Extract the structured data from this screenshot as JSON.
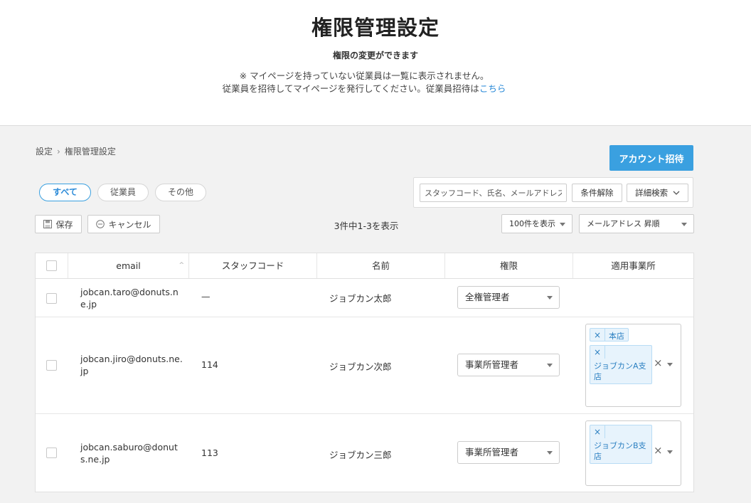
{
  "header": {
    "title": "権限管理設定",
    "subtitle": "権限の変更ができます",
    "note_line1": "※ マイページを持っていない従業員は一覧に表示されません。",
    "note_line2_prefix": "従業員を招待してマイページを発行してください。従業員招待は",
    "note_link": "こちら"
  },
  "breadcrumb": {
    "root": "設定",
    "separator": "›",
    "current": "権限管理設定"
  },
  "invite_button": "アカウント招待",
  "filter_tabs": [
    {
      "label": "すべて",
      "active": true
    },
    {
      "label": "従業員",
      "active": false
    },
    {
      "label": "その他",
      "active": false
    }
  ],
  "search": {
    "placeholder": "スタッフコード、氏名、メールアドレス",
    "clear_label": "条件解除",
    "advanced_label": "詳細検索"
  },
  "toolbar": {
    "save_label": "保存",
    "cancel_label": "キャンセル",
    "count_text": "3件中1-3を表示",
    "per_page": "100件を表示",
    "sort": "メールアドレス 昇順"
  },
  "table": {
    "columns": [
      "email",
      "スタッフコード",
      "名前",
      "権限",
      "適用事業所"
    ],
    "rows": [
      {
        "email": "jobcan.taro@donuts.ne.jp",
        "staff_code": "—",
        "name": "ジョブカン太郎",
        "role": "全権管理者",
        "offices": []
      },
      {
        "email": "jobcan.jiro@donuts.ne.jp",
        "staff_code": "114",
        "name": "ジョブカン次郎",
        "role": "事業所管理者",
        "offices": [
          "本店",
          "ジョブカンA支店"
        ]
      },
      {
        "email": "jobcan.saburo@donuts.ne.jp",
        "staff_code": "113",
        "name": "ジョブカン三郎",
        "role": "事業所管理者",
        "offices": [
          "ジョブカンB支店"
        ]
      }
    ]
  },
  "glyphs": {
    "remove": "×",
    "sort_asc": "^"
  },
  "colors": {
    "accent": "#3aa0e0",
    "link": "#2a8ad8",
    "tag_bg": "#e7f3fc",
    "page_bg": "#f2f2f2"
  }
}
